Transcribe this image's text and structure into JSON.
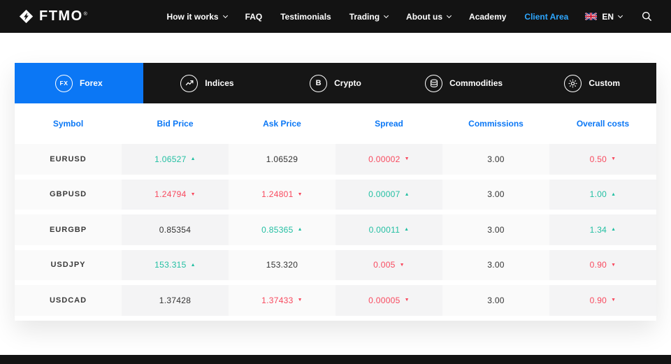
{
  "colors": {
    "accent_blue": "#0b77f5",
    "client_area_blue": "#2ea7ff",
    "up_teal": "#22bfa2",
    "down_red": "#f8495e",
    "navbar_dark": "#131313"
  },
  "navbar": {
    "logo": "FTMO",
    "registered": "®",
    "items": [
      {
        "label": "How it works",
        "caret": true,
        "highlight": false
      },
      {
        "label": "FAQ",
        "caret": false,
        "highlight": false
      },
      {
        "label": "Testimonials",
        "caret": false,
        "highlight": false
      },
      {
        "label": "Trading",
        "caret": true,
        "highlight": false
      },
      {
        "label": "About us",
        "caret": true,
        "highlight": false
      },
      {
        "label": "Academy",
        "caret": false,
        "highlight": false
      },
      {
        "label": "Client Area",
        "caret": false,
        "highlight": true
      }
    ],
    "lang": "EN",
    "flag": "uk-flag-icon",
    "search": "search-icon"
  },
  "tabs": [
    {
      "label": "Forex",
      "icon": "fx-icon",
      "active": true
    },
    {
      "label": "Indices",
      "icon": "indices-icon",
      "active": false
    },
    {
      "label": "Crypto",
      "icon": "crypto-icon",
      "active": false
    },
    {
      "label": "Commodities",
      "icon": "commodities-icon",
      "active": false
    },
    {
      "label": "Custom",
      "icon": "custom-icon",
      "active": false
    }
  ],
  "table": {
    "columns": [
      "Symbol",
      "Bid Price",
      "Ask Price",
      "Spread",
      "Commissions",
      "Overall costs"
    ],
    "rows": [
      {
        "symbol": "EURUSD",
        "bid": {
          "v": "1.06527",
          "dir": "up"
        },
        "ask": {
          "v": "1.06529",
          "dir": "flat"
        },
        "spread": {
          "v": "0.00002",
          "dir": "down"
        },
        "commissions": "3.00",
        "overall": {
          "v": "0.50",
          "dir": "down"
        }
      },
      {
        "symbol": "GBPUSD",
        "bid": {
          "v": "1.24794",
          "dir": "down"
        },
        "ask": {
          "v": "1.24801",
          "dir": "down"
        },
        "spread": {
          "v": "0.00007",
          "dir": "up"
        },
        "commissions": "3.00",
        "overall": {
          "v": "1.00",
          "dir": "up"
        }
      },
      {
        "symbol": "EURGBP",
        "bid": {
          "v": "0.85354",
          "dir": "flat"
        },
        "ask": {
          "v": "0.85365",
          "dir": "up"
        },
        "spread": {
          "v": "0.00011",
          "dir": "up"
        },
        "commissions": "3.00",
        "overall": {
          "v": "1.34",
          "dir": "up"
        }
      },
      {
        "symbol": "USDJPY",
        "bid": {
          "v": "153.315",
          "dir": "up"
        },
        "ask": {
          "v": "153.320",
          "dir": "flat"
        },
        "spread": {
          "v": "0.005",
          "dir": "down"
        },
        "commissions": "3.00",
        "overall": {
          "v": "0.90",
          "dir": "down"
        }
      },
      {
        "symbol": "USDCAD",
        "bid": {
          "v": "1.37428",
          "dir": "flat"
        },
        "ask": {
          "v": "1.37433",
          "dir": "down"
        },
        "spread": {
          "v": "0.00005",
          "dir": "down"
        },
        "commissions": "3.00",
        "overall": {
          "v": "0.90",
          "dir": "down"
        }
      }
    ]
  }
}
